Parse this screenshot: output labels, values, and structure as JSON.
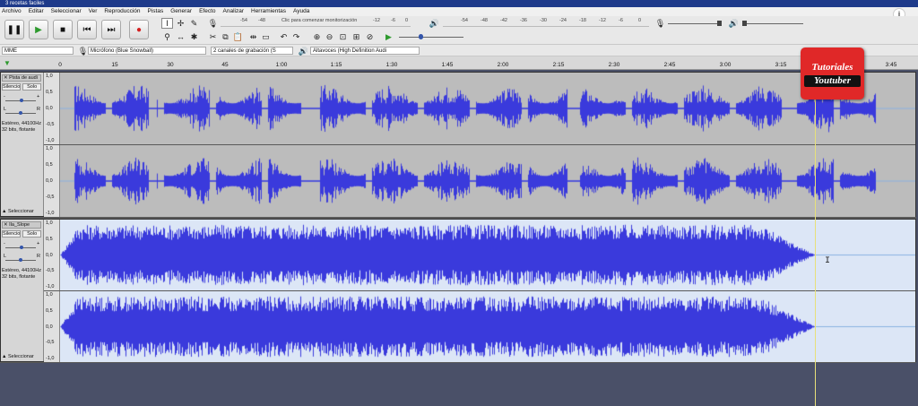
{
  "window": {
    "title": "3 recetas faciles"
  },
  "menu": [
    "Archivo",
    "Editar",
    "Seleccionar",
    "Ver",
    "Reproducción",
    "Pistas",
    "Generar",
    "Efecto",
    "Analizar",
    "Herramientas",
    "Ayuda"
  ],
  "transport": {
    "pause": "pause-icon",
    "play": "play-icon",
    "stop": "stop-icon",
    "skip_start": "skip-start-icon",
    "skip_end": "skip-end-icon",
    "record": "record-icon",
    "play_color": "#2e9a2e",
    "record_color": "#d42020"
  },
  "meters": {
    "record_ticks": [
      "-54",
      "-48",
      "Clic para comenzar monitorización",
      "-12",
      "-6",
      "0"
    ],
    "play_ticks": [
      "-54",
      "-48",
      "-42",
      "-36",
      "-30",
      "-24",
      "-18",
      "-12",
      "-6",
      "0"
    ],
    "lr_labels": [
      "L",
      "R"
    ]
  },
  "devices": {
    "host": "MME",
    "recording": "Micrófono (Blue Snowball)",
    "channels": "2 canales de grabación (S",
    "playback": "Altavoces (High Definition Audi"
  },
  "ruler": {
    "ticks": [
      "0",
      "15",
      "30",
      "45",
      "1:00",
      "1:15",
      "1:30",
      "1:45",
      "2:00",
      "2:15",
      "2:30",
      "2:45",
      "3:00",
      "3:15",
      "3:45"
    ]
  },
  "tracks": [
    {
      "name": "Pista de audi",
      "mute": "Silencio",
      "solo": "Solo",
      "gain": [
        "-",
        "+"
      ],
      "pan": [
        "L",
        "R"
      ],
      "info": "Estéreo, 44100Hz\n32 bits, flotante",
      "select": "Seleccionar",
      "scale": [
        "1,0",
        "0,5",
        "0,0",
        "-0,5",
        "-1,0"
      ]
    },
    {
      "name": "Ila_Slope",
      "mute": "Silencio",
      "solo": "Solo",
      "gain": [
        "-",
        "+"
      ],
      "pan": [
        "L",
        "R"
      ],
      "info": "Estéreo, 44100Hz\n32 bits, flotante",
      "select": "Seleccionar",
      "scale": [
        "1,0",
        "0,5",
        "0,0",
        "-0,5",
        "-1,0"
      ]
    }
  ],
  "colors": {
    "wave": "#3a3adc",
    "track1_bg": "#bcbcbc",
    "track2_bg": "#dce6f6",
    "centerline": "#8ab0e0"
  },
  "watermark": {
    "line1": "Tutoriales",
    "line2": "Youtuber"
  },
  "cursor_char": "I",
  "info_icon": "i"
}
